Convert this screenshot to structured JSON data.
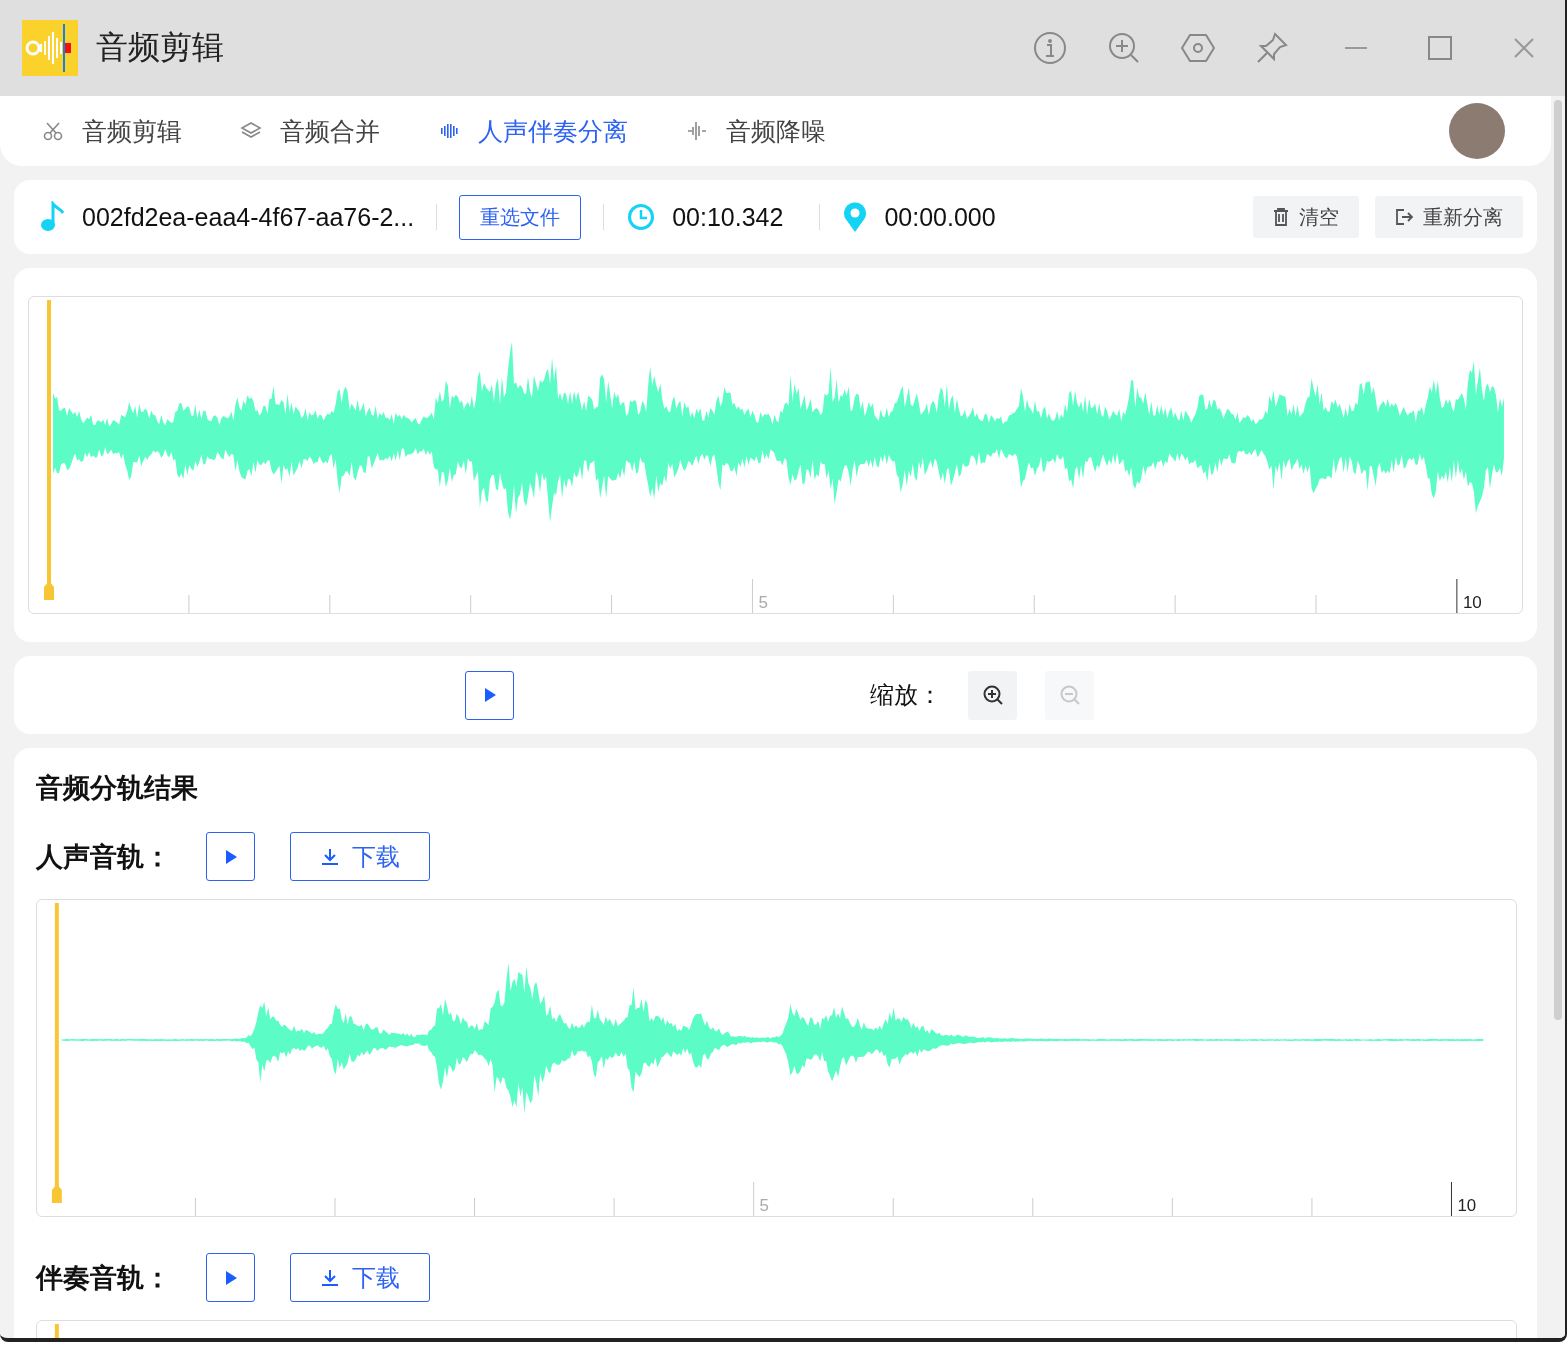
{
  "window": {
    "title": "音频剪辑"
  },
  "tabs": [
    {
      "label": "音频剪辑",
      "selected": false,
      "kind": "scissors"
    },
    {
      "label": "音频合并",
      "selected": false,
      "kind": "layers"
    },
    {
      "label": "人声伴奏分离",
      "selected": true,
      "kind": "bars"
    },
    {
      "label": "音频降噪",
      "selected": false,
      "kind": "pulse"
    }
  ],
  "file_bar": {
    "file_name": "002fd2ea-eaa4-4f67-aa76-2...",
    "reselect_button": "重选文件",
    "duration": "00:10.342",
    "position": "00:00.000",
    "buttons": [
      {
        "label": "清空",
        "kind": "trash"
      },
      {
        "label": "重新分离",
        "kind": "exit"
      }
    ]
  },
  "main_waveform": {
    "ruler_labels": [
      "5",
      "10"
    ]
  },
  "controls": {
    "zoom_label": "缩放：",
    "zoom_buttons": [
      {
        "kind": "zoom_in",
        "disabled": false
      },
      {
        "kind": "zoom_out",
        "disabled": true
      }
    ]
  },
  "results": {
    "title": "音频分轨结果",
    "tracks": [
      {
        "label": "人声音轨：",
        "kind": "vocal",
        "download_button": "下载",
        "ruler_labels": [
          "5",
          "10"
        ]
      },
      {
        "label": "伴奏音轨：",
        "kind": "accompaniment",
        "download_button": "下载"
      }
    ]
  }
}
